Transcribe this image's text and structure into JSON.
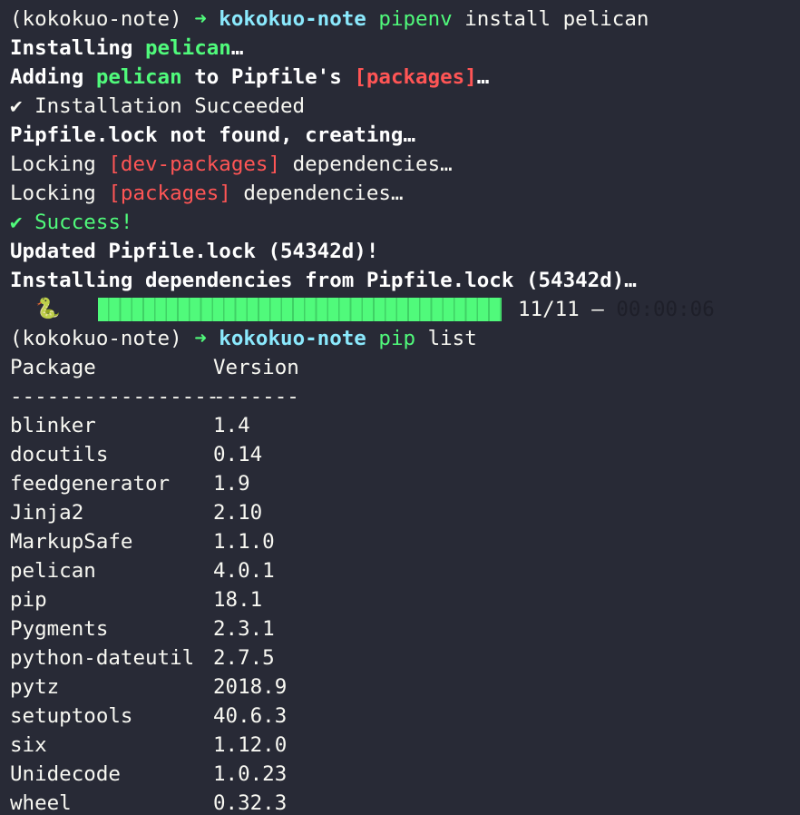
{
  "prompt1": {
    "env": "(kokokuo-note)",
    "arrow": "➜",
    "dir": "kokokuo-note",
    "cmd": "pipenv",
    "args": "install pelican"
  },
  "output": {
    "installing_prefix": "Installing ",
    "installing_pkg": "pelican",
    "installing_suffix": "…",
    "adding_prefix": "Adding ",
    "adding_pkg": "pelican",
    "adding_mid": " to Pipfile's ",
    "adding_section": "[packages]",
    "adding_suffix": "…",
    "install_check": "✔",
    "install_succeeded": " Installation Succeeded",
    "lock_not_found": "Pipfile.lock not found, creating…",
    "locking_dev_prefix": "Locking ",
    "locking_dev_section": "[dev-packages]",
    "locking_dev_suffix": " dependencies…",
    "locking_pkg_prefix": "Locking ",
    "locking_pkg_section": "[packages]",
    "locking_pkg_suffix": " dependencies…",
    "success": "✔ Success!",
    "updated_lock": "Updated Pipfile.lock (54342d)!",
    "installing_deps": "Installing dependencies from Pipfile.lock (54342d)…"
  },
  "progress": {
    "icon": "🐍",
    "fraction": 1.0,
    "count": "11/11",
    "separator": " — ",
    "elapsed": "00:00:06"
  },
  "prompt2": {
    "env": "(kokokuo-note)",
    "arrow": "➜",
    "dir": "kokokuo-note",
    "cmd": "pip",
    "args": "list"
  },
  "table": {
    "header_package": "Package",
    "header_version": "Version",
    "divider_package": "-----------------",
    "divider_version": "-------",
    "rows": [
      {
        "package": "blinker",
        "version": "1.4"
      },
      {
        "package": "docutils",
        "version": "0.14"
      },
      {
        "package": "feedgenerator",
        "version": "1.9"
      },
      {
        "package": "Jinja2",
        "version": "2.10"
      },
      {
        "package": "MarkupSafe",
        "version": "1.1.0"
      },
      {
        "package": "pelican",
        "version": "4.0.1"
      },
      {
        "package": "pip",
        "version": "18.1"
      },
      {
        "package": "Pygments",
        "version": "2.3.1"
      },
      {
        "package": "python-dateutil",
        "version": "2.7.5"
      },
      {
        "package": "pytz",
        "version": "2018.9"
      },
      {
        "package": "setuptools",
        "version": "40.6.3"
      },
      {
        "package": "six",
        "version": "1.12.0"
      },
      {
        "package": "Unidecode",
        "version": "1.0.23"
      },
      {
        "package": "wheel",
        "version": "0.32.3"
      }
    ]
  },
  "colors": {
    "background": "#282a36",
    "foreground": "#f8f8f2",
    "green": "#50fa7b",
    "red": "#ff5555",
    "cyan": "#8be9fd"
  }
}
